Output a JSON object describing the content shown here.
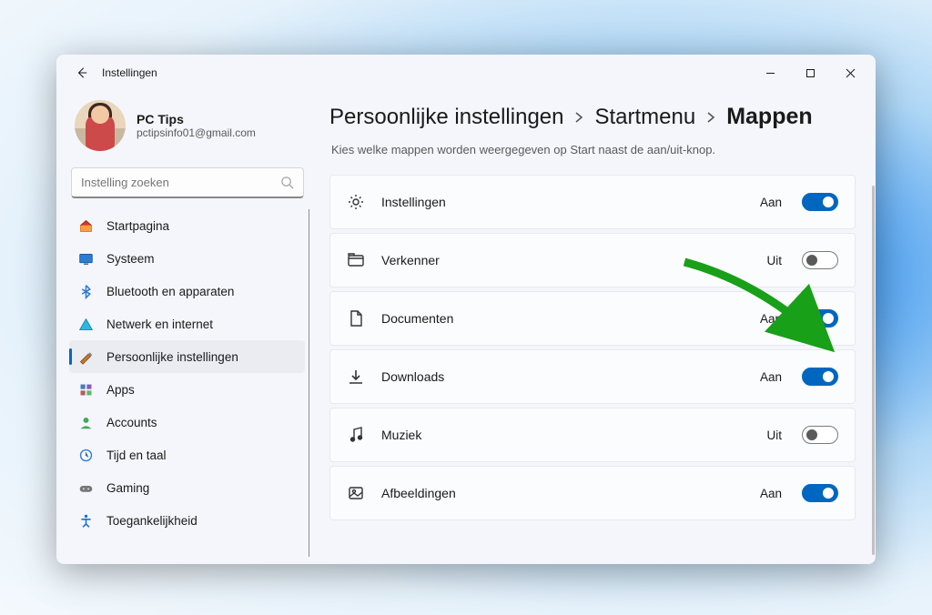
{
  "window": {
    "title": "Instellingen"
  },
  "profile": {
    "name": "PC Tips",
    "email": "pctipsinfo01@gmail.com"
  },
  "search": {
    "placeholder": "Instelling zoeken"
  },
  "sidebar": {
    "items": [
      {
        "label": "Startpagina",
        "icon": "home",
        "selected": false
      },
      {
        "label": "Systeem",
        "icon": "system",
        "selected": false
      },
      {
        "label": "Bluetooth en apparaten",
        "icon": "bluetooth",
        "selected": false
      },
      {
        "label": "Netwerk en internet",
        "icon": "network",
        "selected": false
      },
      {
        "label": "Persoonlijke instellingen",
        "icon": "personalize",
        "selected": true
      },
      {
        "label": "Apps",
        "icon": "apps",
        "selected": false
      },
      {
        "label": "Accounts",
        "icon": "accounts",
        "selected": false
      },
      {
        "label": "Tijd en taal",
        "icon": "time",
        "selected": false
      },
      {
        "label": "Gaming",
        "icon": "gaming",
        "selected": false
      },
      {
        "label": "Toegankelijkheid",
        "icon": "accessibility",
        "selected": false
      }
    ]
  },
  "breadcrumb": {
    "items": [
      "Persoonlijke instellingen",
      "Startmenu",
      "Mappen"
    ]
  },
  "subhead": "Kies welke mappen worden weergegeven op Start naast de aan/uit-knop.",
  "toggle_labels": {
    "on": "Aan",
    "off": "Uit"
  },
  "rows": [
    {
      "label": "Instellingen",
      "icon": "gear",
      "on": true
    },
    {
      "label": "Verkenner",
      "icon": "explorer",
      "on": false
    },
    {
      "label": "Documenten",
      "icon": "document",
      "on": true
    },
    {
      "label": "Downloads",
      "icon": "download",
      "on": true
    },
    {
      "label": "Muziek",
      "icon": "music",
      "on": false
    },
    {
      "label": "Afbeeldingen",
      "icon": "picture",
      "on": true
    }
  ]
}
